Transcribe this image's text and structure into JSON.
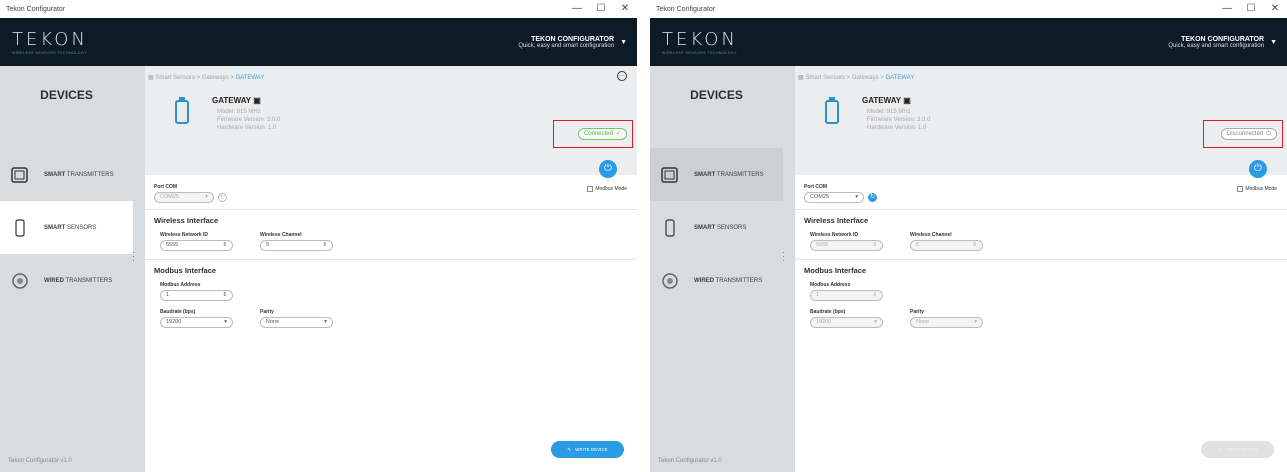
{
  "windows": [
    {
      "title": "Tekon Configurator",
      "controls": {
        "minimize": "—",
        "maximize": "☐",
        "close": "✕"
      },
      "header": {
        "logo": "TEKON",
        "logo_sub": "WIRELESS SENSORS TECHNOLOGY",
        "title": "TEKON CONFIGURATOR",
        "subtitle": "Quick, easy and smart configuration",
        "caret": "▼"
      },
      "sidebar": {
        "title": "DEVICES",
        "items": [
          {
            "bold": "SMART",
            "rest": " TRANSMITTERS",
            "icon": "transmitter-icon",
            "active": false
          },
          {
            "bold": "SMART",
            "rest": " SENSORS",
            "icon": "sensor-icon",
            "active": true
          },
          {
            "bold": "WIRED",
            "rest": " TRANSMITTERS",
            "icon": "wired-icon",
            "active": false
          }
        ],
        "footer": "Tekon Configurator v1.0"
      },
      "breadcrumb": {
        "b1": "Smart Sensors",
        "b2": "Gateways",
        "b3": "GATEWAY",
        "sep": ">"
      },
      "device": {
        "name": "GATEWAY",
        "model": "Model: 915 MHz",
        "firmware": "Firmware Version: 3.0.0",
        "hardware": "Hardware Version: 1.0"
      },
      "status": {
        "label": "Connected",
        "icon": "✓",
        "state": "connected"
      },
      "port": {
        "label": "Port COM",
        "value": "COM25",
        "caret": "▾",
        "refresh": "↻",
        "enabled": false
      },
      "modbus_mode": "Modbus Mode",
      "power_icon": "⏻",
      "wireless": {
        "title": "Wireless Interface",
        "network_label": "Wireless Network ID",
        "network_value": "5555",
        "channel_label": "Wireless Channel",
        "channel_value": "5",
        "enabled": true
      },
      "modbus": {
        "title": "Modbus Interface",
        "address_label": "Modbus Address",
        "address_value": "1",
        "baud_label": "Baudrate (bps)",
        "baud_value": "19200",
        "parity_label": "Parity",
        "parity_value": "None",
        "enabled": true
      },
      "write": {
        "label": "WRITE DEVICE",
        "icon": "✎",
        "enabled": true
      },
      "stepper": "⇕",
      "more": "…"
    },
    {
      "title": "Tekon Configurator",
      "controls": {
        "minimize": "—",
        "maximize": "☐",
        "close": "✕"
      },
      "header": {
        "logo": "TEKON",
        "logo_sub": "WIRELESS SENSORS TECHNOLOGY",
        "title": "TEKON CONFIGURATOR",
        "subtitle": "Quick, easy and smart configuration",
        "caret": "▼"
      },
      "sidebar": {
        "title": "DEVICES",
        "items": [
          {
            "bold": "SMART",
            "rest": " TRANSMITTERS",
            "icon": "transmitter-icon",
            "active": true
          },
          {
            "bold": "SMART",
            "rest": " SENSORS",
            "icon": "sensor-icon",
            "active": false
          },
          {
            "bold": "WIRED",
            "rest": " TRANSMITTERS",
            "icon": "wired-icon",
            "active": false
          }
        ],
        "footer": "Tekon Configurator v1.0"
      },
      "breadcrumb": {
        "b1": "Smart Sensors",
        "b2": "Gateways",
        "b3": "GATEWAY",
        "sep": ">"
      },
      "device": {
        "name": "GATEWAY",
        "model": "Model: 915 MHz",
        "firmware": "Firmware Version: 3.0.0",
        "hardware": "Hardware Version: 1.0"
      },
      "status": {
        "label": "Disconnected",
        "icon": "⏻",
        "state": "disconnected"
      },
      "port": {
        "label": "Port COM",
        "value": "COM25",
        "caret": "▾",
        "refresh": "↻",
        "enabled": true
      },
      "modbus_mode": "Modbus Mode",
      "power_icon": "⏻",
      "wireless": {
        "title": "Wireless Interface",
        "network_label": "Wireless Network ID",
        "network_value": "5555",
        "channel_label": "Wireless Channel",
        "channel_value": "5",
        "enabled": false
      },
      "modbus": {
        "title": "Modbus Interface",
        "address_label": "Modbus Address",
        "address_value": "1",
        "baud_label": "Baudrate (bps)",
        "baud_value": "19200",
        "parity_label": "Parity",
        "parity_value": "None",
        "enabled": false
      },
      "write": {
        "label": "WRITE DEVICE",
        "icon": "✎",
        "enabled": false
      },
      "stepper": "⇕",
      "more": "…"
    }
  ],
  "colors": {
    "accent": "#2b9be3",
    "header_bg": "#0d1b26",
    "connected": "#63b14f",
    "highlight": "#d21f2a"
  }
}
